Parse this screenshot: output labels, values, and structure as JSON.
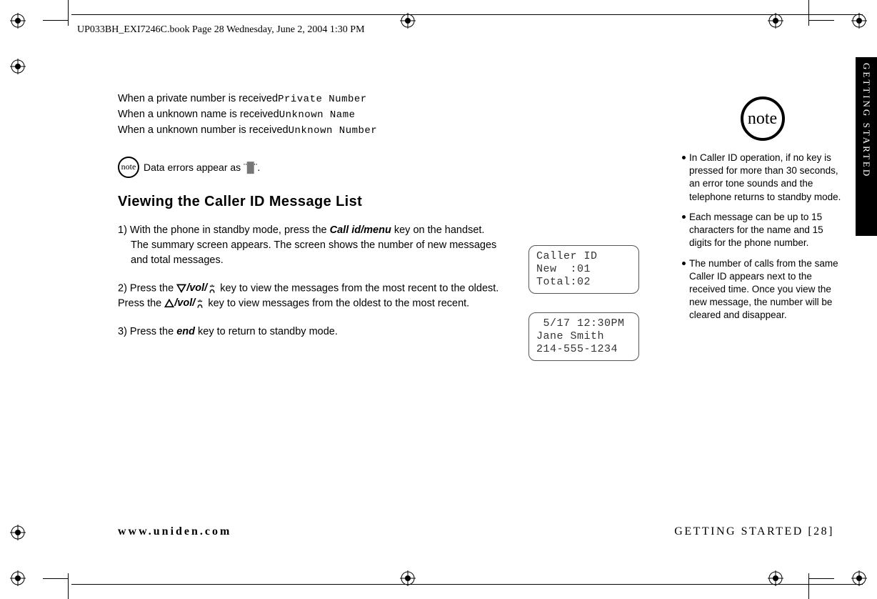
{
  "header": {
    "book_info": "UP033BH_EXI7246C.book  Page 28  Wednesday, June 2, 2004  1:30 PM"
  },
  "side_tab": "GETTING STARTED",
  "intro": {
    "l1a": "When a private number is received",
    "l1b": "Private Number",
    "l2a": "When a unknown name is received",
    "l2b": "Unknown Name",
    "l3a": "When a unknown number is received",
    "l3b": "Unknown Number"
  },
  "inline_note": {
    "icon": "note",
    "text1": "Data errors appear as ¨",
    "text2": "¨."
  },
  "section_heading": "Viewing the Caller ID Message List",
  "steps": {
    "s1a": "1) With the phone in standby mode, press the ",
    "s1_key": "Call id/menu",
    "s1b": " key on the handset.",
    "s1c": "The summary screen appears. The screen shows the number of new messages and total messages.",
    "s2a": "2) Press the ",
    "s2_vol1": "/vol/",
    "s2b": " key to view the messages from the most recent to the oldest.  Press the ",
    "s2_vol2": "/vol/",
    "s2c": " key to view messages from the oldest to the most recent.",
    "s3a": "3) Press the ",
    "s3_key": "end",
    "s3b": " key to return to standby mode."
  },
  "lcd": {
    "screen1": "Caller ID\nNew  :01\nTotal:02",
    "screen2": " 5/17 12:30PM\nJane Smith\n214-555-1234"
  },
  "margin_note": {
    "icon": "note",
    "b1": "In Caller ID operation, if no key is pressed for more than 30 seconds, an error tone sounds and the telephone returns to standby mode.",
    "b2": "Each message can be up to 15 characters for the name and 15 digits for the phone number.",
    "b3": "The number of calls from the same Caller ID appears next to the received time. Once you view the new message, the number will be cleared and disappear."
  },
  "footer": {
    "left": "www.uniden.com",
    "right": "GETTING STARTED [28]"
  }
}
